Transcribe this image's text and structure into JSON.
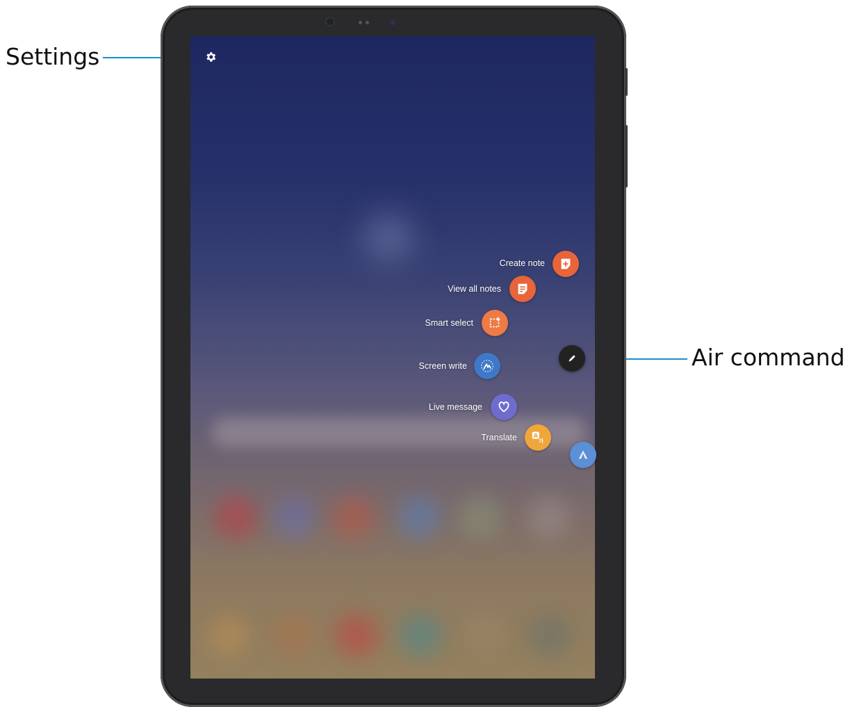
{
  "callouts": {
    "settings": "Settings",
    "air_command": "Air command"
  },
  "menu": {
    "items": [
      {
        "label": "Create note",
        "icon": "create-note-icon",
        "color": "#e8643a"
      },
      {
        "label": "View all notes",
        "icon": "view-notes-icon",
        "color": "#e8643a"
      },
      {
        "label": "Smart select",
        "icon": "smart-select-icon",
        "color": "#ee7a45"
      },
      {
        "label": "Screen write",
        "icon": "screen-write-icon",
        "color": "#3f78c8"
      },
      {
        "label": "Live message",
        "icon": "live-message-icon",
        "color": "#6f6ccf"
      },
      {
        "label": "Translate",
        "icon": "translate-icon",
        "color": "#f0a63a"
      }
    ]
  },
  "colors": {
    "callout_line": "#1a8fc9",
    "air_command_button": "#222222"
  }
}
